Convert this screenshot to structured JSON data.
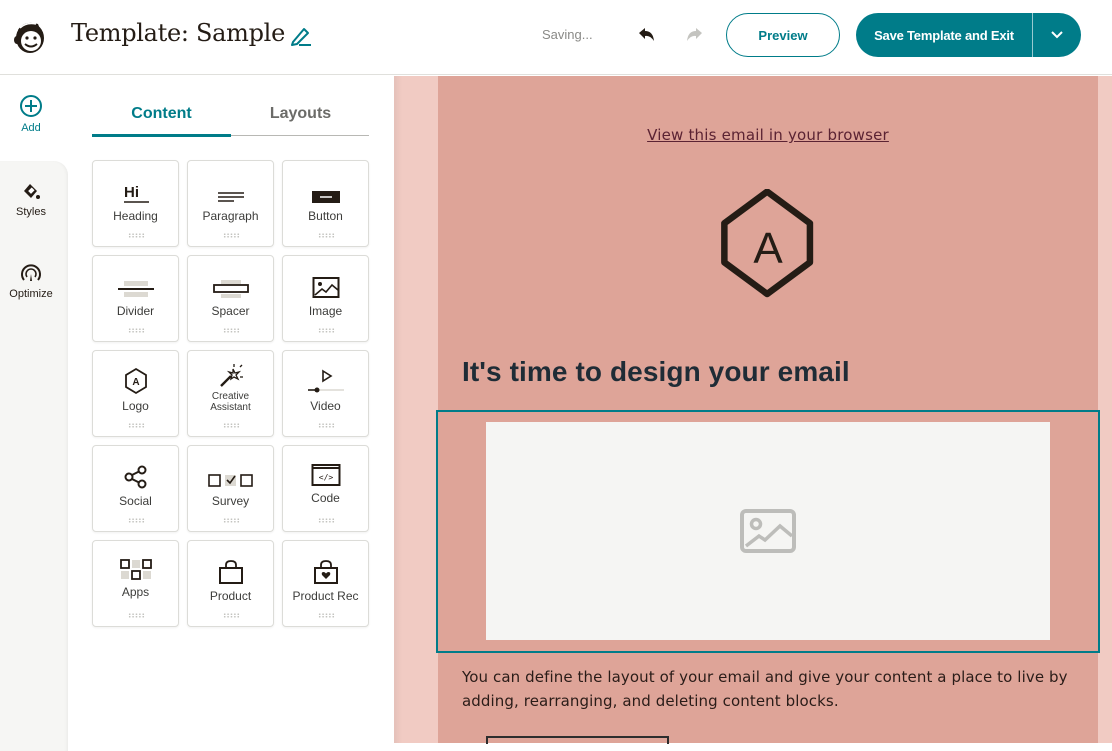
{
  "header": {
    "title": "Template: Sample",
    "status": "Saving...",
    "preview_label": "Preview",
    "save_label": "Save Template and Exit",
    "icons": {
      "logo": "mailchimp-logo",
      "edit": "pencil-icon",
      "undo": "undo-icon",
      "redo": "redo-icon",
      "dropdown": "chevron-down-icon"
    }
  },
  "rail": {
    "items": [
      {
        "label": "Add",
        "icon": "plus-circle-icon"
      },
      {
        "label": "Styles",
        "icon": "paint-bucket-icon"
      },
      {
        "label": "Optimize",
        "icon": "gauge-icon"
      }
    ]
  },
  "panel": {
    "tabs": [
      {
        "label": "Content",
        "active": true
      },
      {
        "label": "Layouts",
        "active": false
      }
    ],
    "blocks": [
      {
        "label": "Heading",
        "icon": "heading-icon"
      },
      {
        "label": "Paragraph",
        "icon": "paragraph-icon"
      },
      {
        "label": "Button",
        "icon": "button-icon"
      },
      {
        "label": "Divider",
        "icon": "divider-icon"
      },
      {
        "label": "Spacer",
        "icon": "spacer-icon"
      },
      {
        "label": "Image",
        "icon": "image-icon"
      },
      {
        "label": "Logo",
        "icon": "logo-hex-icon"
      },
      {
        "label": "Creative Assistant",
        "icon": "magic-wand-icon"
      },
      {
        "label": "Video",
        "icon": "video-icon"
      },
      {
        "label": "Social",
        "icon": "share-icon"
      },
      {
        "label": "Survey",
        "icon": "survey-icon"
      },
      {
        "label": "Code",
        "icon": "code-icon"
      },
      {
        "label": "Apps",
        "icon": "apps-icon"
      },
      {
        "label": "Product",
        "icon": "bag-icon"
      },
      {
        "label": "Product Rec",
        "icon": "bag-heart-icon"
      }
    ],
    "heading_icon_text": "Hi",
    "code_icon_text": "</>"
  },
  "email": {
    "view_link": "View this email in your browser",
    "logo_letter": "A",
    "heading": "It's time to design your email",
    "paragraph": "You can define the layout of your email and give your content a place to live by adding, rearranging, and deleting content blocks."
  },
  "colors": {
    "accent": "#007c89",
    "canvas_bg": "#f1cbc3",
    "email_bg": "#dea498",
    "link": "#5b2333",
    "heading": "#1f2c36"
  }
}
